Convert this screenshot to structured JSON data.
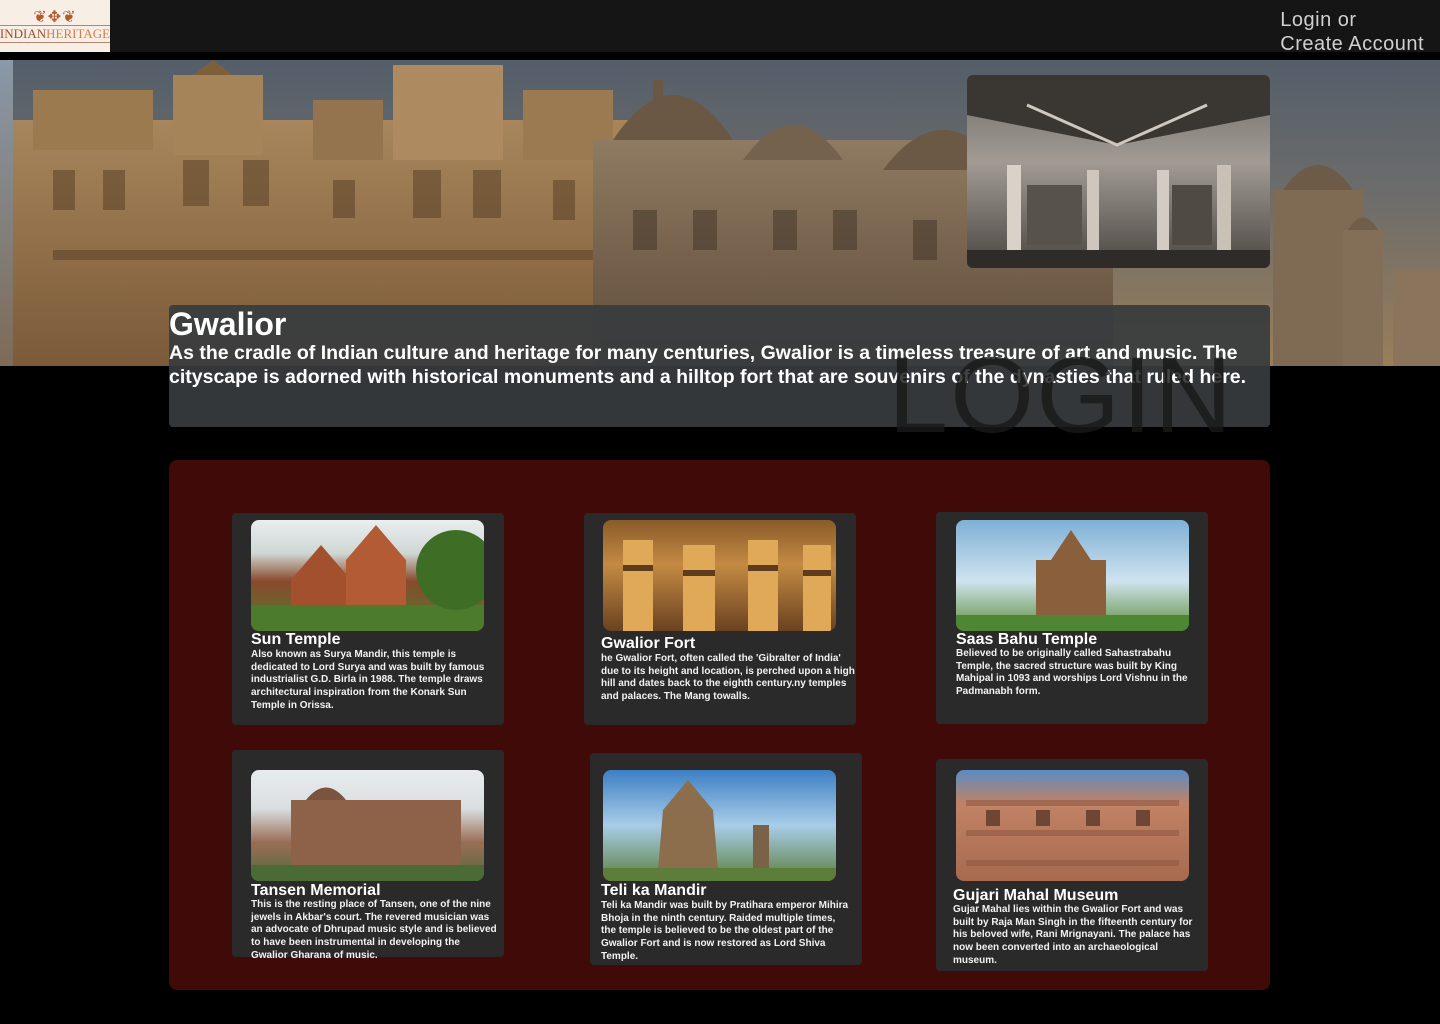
{
  "header": {
    "logo": {
      "text_main": "INDIAN",
      "text_accent": "HERITAGE"
    },
    "auth": {
      "login_label": "Login or",
      "create_label": "Create Account"
    }
  },
  "intro": {
    "title": "Gwalior",
    "description": "As the cradle of Indian culture and heritage for many centuries, Gwalior is a timeless treasure of art and music. The cityscape is adorned with historical monuments and a hilltop fort that are souvenirs of the dynasties that ruled here.",
    "watermark": "LOGIN"
  },
  "places": [
    {
      "title": "Sun Temple",
      "description": "Also known as Surya Mandir, this temple is dedicated to Lord Surya and was built by famous industrialist G.D. Birla in 1988. The temple draws architectural inspiration from the Konark Sun Temple in Orissa."
    },
    {
      "title": "Gwalior Fort",
      "description": "he Gwalior Fort, often called the 'Gibralter of India' due to its height and location, is perched upon a high hill and dates back to the eighth century.ny temples and palaces. The Mang towalls."
    },
    {
      "title": "Saas Bahu Temple",
      "description": "Believed to be originally called Sahastrabahu Temple, the sacred structure was built by King Mahipal in 1093 and worships Lord Vishnu in the Padmanabh form."
    },
    {
      "title": "Tansen Memorial",
      "description": "This is the resting place of Tansen, one of the nine jewels in Akbar's court. The revered musician was an advocate of Dhrupad music style and is believed to have been instrumental in developing the Gwalior Gharana of music."
    },
    {
      "title": "Teli ka Mandir",
      "description": "Teli ka Mandir was built by Pratihara emperor Mihira Bhoja in the ninth century. Raided multiple times, the temple is believed to be the oldest part of the Gwalior Fort and is now restored as Lord Shiva Temple."
    },
    {
      "title": "Gujari Mahal Museum",
      "description": "Gujar Mahal lies within the Gwalior Fort and was built by Raja Man Singh in the fifteenth century for his beloved wife, Rani Mrignayani. The palace has now been converted into an archaeological museum."
    }
  ]
}
